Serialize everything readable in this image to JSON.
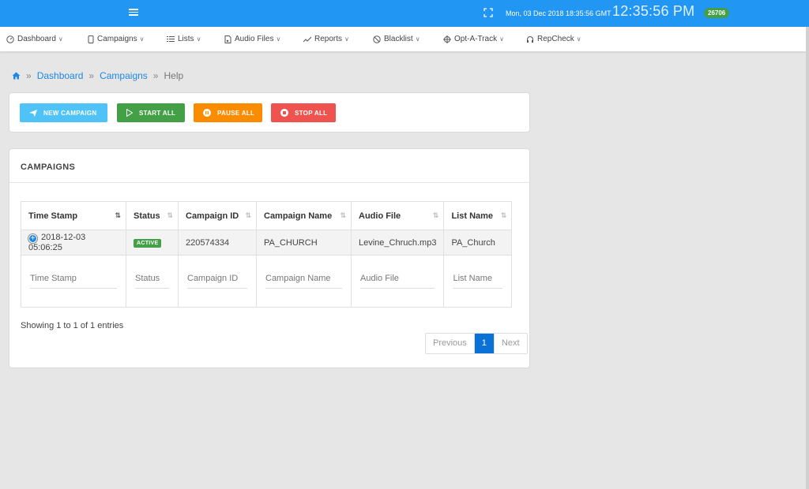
{
  "topbar": {
    "datetime": "Mon, 03 Dec 2018 18:35:56 GMT",
    "clock": "12:35:56 PM",
    "badge": "26706",
    "color": "#2196f3"
  },
  "nav": [
    {
      "label": "Dashboard",
      "icon": "gauge-icon"
    },
    {
      "label": "Campaigns",
      "icon": "phone-icon"
    },
    {
      "label": "Lists",
      "icon": "list-icon"
    },
    {
      "label": "Audio Files",
      "icon": "music-file-icon"
    },
    {
      "label": "Reports",
      "icon": "line-chart-icon"
    },
    {
      "label": "Blacklist",
      "icon": "ban-icon"
    },
    {
      "label": "Opt-A-Track",
      "icon": "crosshair-icon"
    },
    {
      "label": "RepCheck",
      "icon": "headset-icon"
    }
  ],
  "breadcrumb": {
    "sep": "»",
    "items": [
      "Dashboard",
      "Campaigns"
    ],
    "current": "Help"
  },
  "actions": {
    "new_campaign": "NEW CAMPAIGN",
    "start_all": "START ALL",
    "pause_all": "PAUSE ALL",
    "stop_all": "STOP ALL"
  },
  "campaigns": {
    "title": "CAMPAIGNS",
    "columns": [
      "Time Stamp",
      "Status",
      "Campaign ID",
      "Campaign Name",
      "Audio File",
      "List Name"
    ],
    "rows": [
      {
        "timestamp": "2018-12-03 05:06:25",
        "status": "ACTIVE",
        "campaign_id": "220574334",
        "campaign_name": "PA_CHURCH",
        "audio_file": "Levine_Chruch.mp3",
        "list_name": "PA_Church"
      }
    ],
    "footer_filters": [
      "Time Stamp",
      "Status",
      "Campaign ID",
      "Campaign Name",
      "Audio File",
      "List Name"
    ],
    "info": "Showing 1 to 1 of 1 entries",
    "pager": {
      "previous": "Previous",
      "current": "1",
      "next": "Next"
    }
  }
}
